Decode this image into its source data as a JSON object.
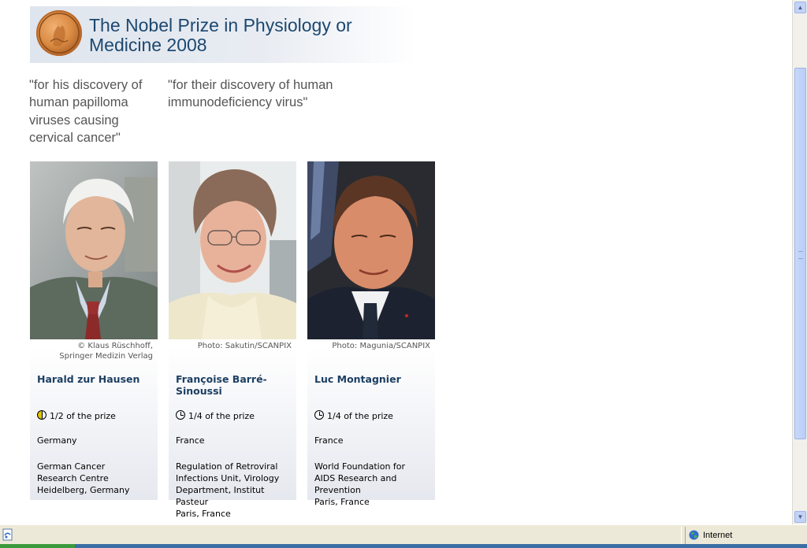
{
  "header": {
    "title": "The Nobel Prize in Physiology or Medicine 2008"
  },
  "motivations": [
    "\"for his discovery of human papilloma viruses causing cervical cancer\"",
    "\"for their discovery of human immunodeficiency virus\""
  ],
  "laureates": [
    {
      "name": "Harald zur Hausen",
      "credit": "© Klaus Rüschhoff,\nSpringer Medizin Verlag",
      "share": "1/2 of the prize",
      "country": "Germany",
      "affiliation": "German Cancer\nResearch Centre\nHeidelberg, Germany"
    },
    {
      "name": "Françoise Barré-Sinoussi",
      "credit": "Photo: Sakutin/SCANPIX",
      "share": "1/4 of the prize",
      "country": "France",
      "affiliation": "Regulation of Retroviral\nInfections Unit, Virology\nDepartment, Institut\nPasteur\nParis, France"
    },
    {
      "name": "Luc Montagnier",
      "credit": "Photo: Magunia/SCANPIX",
      "share": "1/4 of the prize",
      "country": "France",
      "affiliation": "World Foundation for\nAIDS Research and\nPrevention\nParis, France"
    }
  ],
  "statusbar": {
    "zone": "Internet"
  },
  "colors": {
    "title": "#1c4870",
    "laureate_name": "#1c3f62",
    "half_share_icon": "#e0c400"
  },
  "icons": [
    "nobel-medal",
    "half-share-icon",
    "quarter-share-icon",
    "page-icon",
    "internet-globe-icon"
  ]
}
